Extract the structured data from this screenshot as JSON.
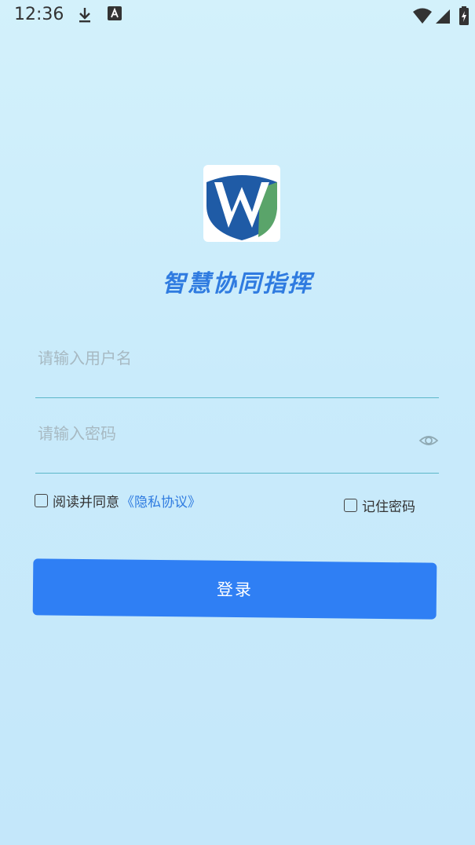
{
  "status_bar": {
    "time": "12:36",
    "icons": [
      "download-icon",
      "a-icon",
      "wifi-icon",
      "signal-icon",
      "battery-icon"
    ]
  },
  "app": {
    "title": "智慧协同指挥",
    "logo_icon": "shield-w-logo-icon"
  },
  "login_form": {
    "username_placeholder": "请输入用户名",
    "username_value": "",
    "password_placeholder": "请输入密码",
    "password_value": "",
    "agree_label": "阅读并同意",
    "privacy_link": "《隐私协议》",
    "agree_checked": false,
    "remember_label": "记住密码",
    "remember_checked": false,
    "login_label": "登录"
  },
  "colors": {
    "accent": "#2f7ff4",
    "title": "#2f7be0",
    "underline": "#5cb7c9"
  }
}
